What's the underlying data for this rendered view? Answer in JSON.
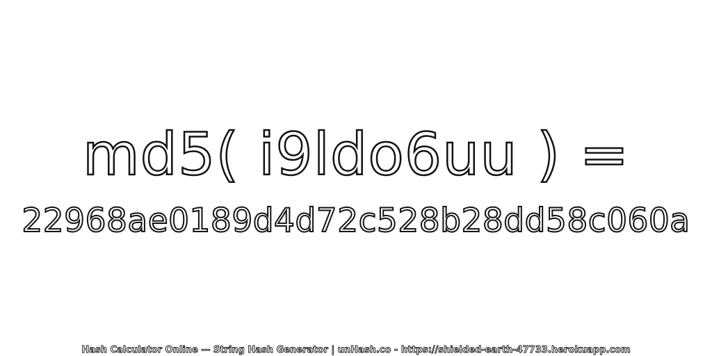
{
  "headline": "md5( i9ldo6uu ) =",
  "hash_value": "22968ae0189d4d72c528b28dd58c060a",
  "footer": "Hash Calculator Online — String Hash Generator | unHash.co - https://shielded-earth-47733.herokuapp.com",
  "colors": {
    "background": "#ffffff",
    "text_fill": "#ffffff",
    "text_outline": "#111111"
  }
}
